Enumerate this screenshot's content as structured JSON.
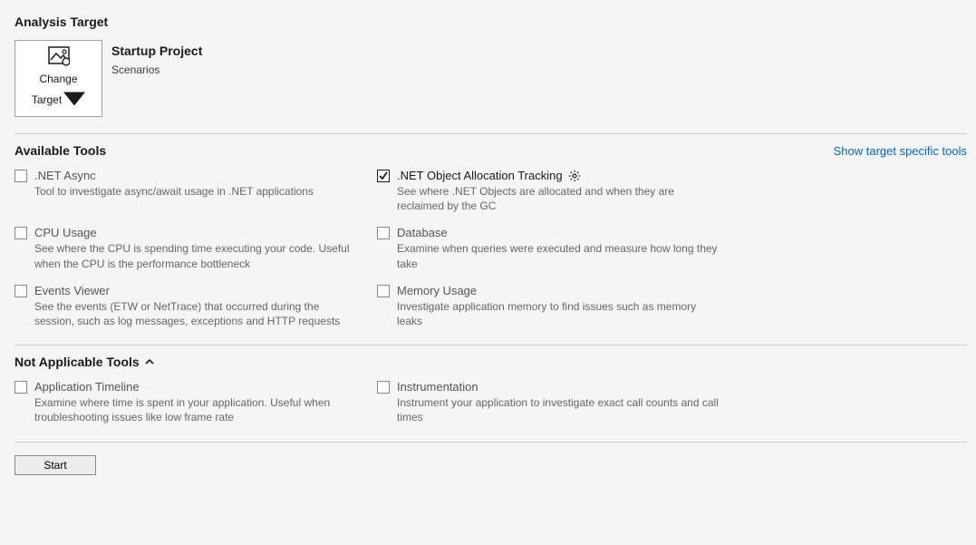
{
  "target_section": {
    "heading": "Analysis Target",
    "change_label_line1": "Change",
    "change_label_line2": "Target",
    "project_title": "Startup Project",
    "project_subtitle": "Scenarios"
  },
  "available_tools": {
    "heading": "Available Tools",
    "show_link": "Show target specific tools",
    "items": [
      {
        "id": "net-async",
        "label": ".NET Async",
        "desc": "Tool to investigate async/await usage in .NET applications",
        "checked": false,
        "has_settings": false
      },
      {
        "id": "net-object-alloc",
        "label": ".NET Object Allocation Tracking",
        "desc": "See where .NET Objects are allocated and when they are reclaimed by the GC",
        "checked": true,
        "has_settings": true
      },
      {
        "id": "cpu-usage",
        "label": "CPU Usage",
        "desc": "See where the CPU is spending time executing your code. Useful when the CPU is the performance bottleneck",
        "checked": false,
        "has_settings": false
      },
      {
        "id": "database",
        "label": "Database",
        "desc": "Examine when queries were executed and measure how long they take",
        "checked": false,
        "has_settings": false
      },
      {
        "id": "events-viewer",
        "label": "Events Viewer",
        "desc": "See the events (ETW or NetTrace) that occurred during the session, such as log messages, exceptions and HTTP requests",
        "checked": false,
        "has_settings": false
      },
      {
        "id": "memory-usage",
        "label": "Memory Usage",
        "desc": "Investigate application memory to find issues such as memory leaks",
        "checked": false,
        "has_settings": false
      }
    ]
  },
  "not_applicable": {
    "heading": "Not Applicable Tools",
    "items": [
      {
        "id": "app-timeline",
        "label": "Application Timeline",
        "desc": "Examine where time is spent in your application. Useful when troubleshooting issues like low frame rate",
        "checked": false
      },
      {
        "id": "instrumentation",
        "label": "Instrumentation",
        "desc": "Instrument your application to investigate exact call counts and call times",
        "checked": false
      }
    ]
  },
  "start_button": "Start"
}
